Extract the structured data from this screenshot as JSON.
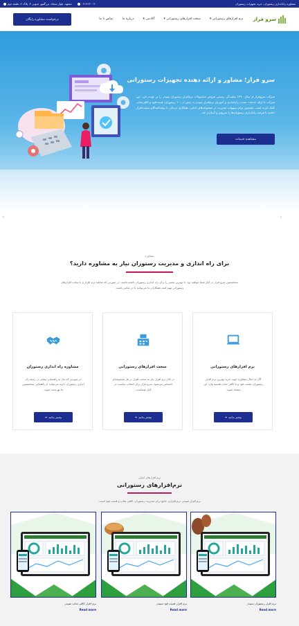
{
  "topbar": {
    "left_text": "مشاوره راه‌اندازی رستوران، خرید تجهیزات رستوران",
    "phone": "۰۲۱۹۱۳۰۰۷۰",
    "address": "مشهد، بلوار سجاد، بزرگمهر جنوبی ۳، پلاک ۲، طبقه دوم"
  },
  "header": {
    "consult_button": "درخواست مشاوره رایگان",
    "nav": [
      {
        "label": "نرم افزارهای رستورانی",
        "dropdown": true
      },
      {
        "label": "سخت افزارهای رستورانی",
        "dropdown": true
      },
      {
        "label": "آکادمی",
        "dropdown": true
      },
      {
        "label": "درباره ما",
        "dropdown": false
      },
      {
        "label": "تماس با ما",
        "dropdown": false
      }
    ],
    "logo_text": "سرو فراز"
  },
  "hero": {
    "title": "سرو فراز؛ مشاور و ارائه دهنده تجهیزات رستورانی",
    "body": "شرکت سروفراز از سال ۱۳۹۰ نمایندگی رسمی فروش محصولات نرم‌افزار رستوران سپیدز را بر عهده دارد. این شرکت با ارائه خدمات نصب، راه‌اندازی و آموزش نرم‌افزار سپیدز به بیش از ۱۰۰ رستوران، فست‌فود و کافی‌شاپ کمک کرده است. همچنین برای سهولت مدیریت در مجموعه‌های غذایی، همکاری نزدیکی با تولیدکنندگان سخت‌افزار داشته تا فرایند راه‌اندازی رستوران‌ها را سریع‌تر و آسان‌تر کند.",
    "button": "مشاهده خدمات"
  },
  "consult": {
    "kicker": "مشاوره",
    "title": "برای راه اندازی و مدیریت رستوران نیاز به مشاوره دارید؟",
    "desc": "متخصصین سرو فراز در کنار شما خواهند بود، تا بهترین مسیر را برای راه اندازی رستوران داشته باشید. در صورتی که تمایلید نرم افزار و یا سخت افزارهای رستورانی تهیه کنید، همکاران ما می‌توانند تا در تماس باشند.",
    "cards": [
      {
        "title": "مشاوره راه اندازی رستوران",
        "text": "در صورتی که نیاز به راهنمایی بیشتر در زمینه راه اندازی رستوران دارید می‌توانید از راهنمایی متخصصین ما بهره‌مند شوید.",
        "button": "بیشتر بدانید",
        "icon": "handshake-icon"
      },
      {
        "title": "سخت افزارهای رستورانی",
        "text": "در کنار نرم افزار نیاز به سخت افزار در هر مجموعه‌ای احساس می‌شود. سرو فراز برای انتخاب مناسب در کنار شماست.",
        "button": "بیشتر بدانید",
        "icon": "cash-register-icon"
      },
      {
        "title": "نرم افزارهای رستورانی",
        "text": "اگر به دنبال مشاوره جهت خرید بهترین نرم افزار رستوران، فست فود و یا کافی شاپ هستید وارد این صفحه شوید.",
        "button": "بیشتر بدانید",
        "icon": "laptop-icon"
      }
    ]
  },
  "software": {
    "kicker": "نرم افزارهای اصلی",
    "title": "نرم‌افزارهای رستورانی",
    "desc": "نرم افزار سپیدز، نرم افزاری جامع برای مدیریت رستوران، کافی شاپ و فست فود است.",
    "products": [
      {
        "name": "نرم افزار کافی شاپ سپیدز",
        "more": "Read more"
      },
      {
        "name": "نرم افزار فست فود سپیدز",
        "more": "Read more"
      },
      {
        "name": "نرم افزار رستوران سپیدز",
        "more": "Read more"
      }
    ]
  },
  "colors": {
    "brand_blue": "#1c2e8f",
    "hero_blue": "#2f9bdc",
    "accent_pink": "#c2185b",
    "logo_green": "#7cb342"
  }
}
